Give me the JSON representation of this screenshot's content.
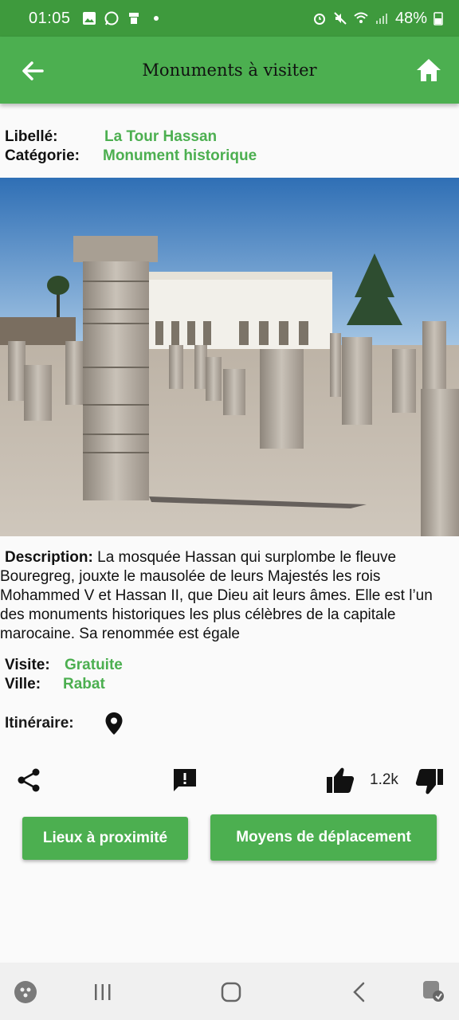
{
  "status": {
    "time": "01:05",
    "battery": "48%"
  },
  "app_bar": {
    "title": "Monuments à visiter"
  },
  "details": {
    "name_label": "Libellé:",
    "name_value": "La Tour Hassan",
    "category_label": "Catégorie:",
    "category_value": "Monument historique"
  },
  "description": {
    "label": "Description:",
    "text": " La mosquée Hassan qui surplombe le fleuve Bouregreg, jouxte le mausolée de leurs Majestés les rois Mohammed V et Hassan II, que Dieu ait leurs âmes. Elle est l’un des monuments historiques les plus célèbres de la capitale marocaine. Sa renommée est égale"
  },
  "visit": {
    "visit_label": "Visite:",
    "visit_value": "Gratuite",
    "city_label": "Ville:",
    "city_value": "Rabat",
    "itinerary_label": "Itinéraire:"
  },
  "actions": {
    "likes": "1.2k"
  },
  "buttons": {
    "nearby": "Lieux à proximité",
    "transport": "Moyens de déplacement"
  },
  "icons": [
    "arrow-back-icon",
    "home-icon",
    "location-pin-icon",
    "share-icon",
    "report-icon",
    "thumb-up-icon",
    "thumb-down-icon"
  ],
  "colors": {
    "status_bar": "#3e9a3d",
    "app_bar": "#4caf50",
    "accent_text": "#4caf50"
  }
}
